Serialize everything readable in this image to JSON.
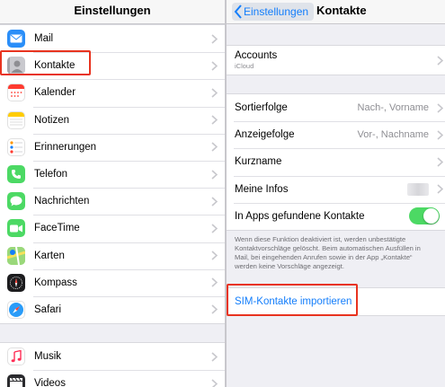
{
  "left": {
    "title": "Einstellungen",
    "items": [
      {
        "label": "Mail",
        "icon": "mail-icon",
        "color": "#2a8ef8"
      },
      {
        "label": "Kontakte",
        "icon": "contacts-icon",
        "color": "#9a9a9f"
      },
      {
        "label": "Kalender",
        "icon": "calendar-icon",
        "color": "#ffffff"
      },
      {
        "label": "Notizen",
        "icon": "notes-icon",
        "color": "#ffcc00"
      },
      {
        "label": "Erinnerungen",
        "icon": "reminders-icon",
        "color": "#ffffff"
      },
      {
        "label": "Telefon",
        "icon": "phone-icon",
        "color": "#4cd964"
      },
      {
        "label": "Nachrichten",
        "icon": "messages-icon",
        "color": "#4cd964"
      },
      {
        "label": "FaceTime",
        "icon": "facetime-icon",
        "color": "#4cd964"
      },
      {
        "label": "Karten",
        "icon": "maps-icon",
        "color": "#5fbf4f"
      },
      {
        "label": "Kompass",
        "icon": "compass-icon",
        "color": "#1c1c1e"
      },
      {
        "label": "Safari",
        "icon": "safari-icon",
        "color": "#ffffff"
      }
    ],
    "items2": [
      {
        "label": "Musik",
        "icon": "music-icon",
        "color": "#ffffff"
      },
      {
        "label": "Videos",
        "icon": "videos-icon",
        "color": "#2b2b2e"
      }
    ]
  },
  "right": {
    "back_label": "Einstellungen",
    "title": "Kontakte",
    "accounts": {
      "label": "Accounts",
      "sub": "iCloud"
    },
    "rows": {
      "sort": {
        "label": "Sortierfolge",
        "value": "Nach-, Vorname"
      },
      "display": {
        "label": "Anzeigefolge",
        "value": "Vor-, Nachname"
      },
      "short": {
        "label": "Kurzname"
      },
      "myinfo": {
        "label": "Meine Infos"
      },
      "inapps": {
        "label": "In Apps gefundene Kontakte",
        "toggle_on": true
      }
    },
    "footnote": "Wenn diese Funktion deaktiviert ist, werden unbestätigte Kontaktvorschläge gelöscht. Beim automatischen Ausfüllen in Mail, bei eingehenden Anrufen sowie in der App „Kontakte“ werden keine Vorschläge angezeigt.",
    "sim_import": "SIM-Kontakte importieren"
  },
  "colors": {
    "accent": "#147efb",
    "highlight": "#e8331f",
    "toggle_on": "#4cd964"
  }
}
